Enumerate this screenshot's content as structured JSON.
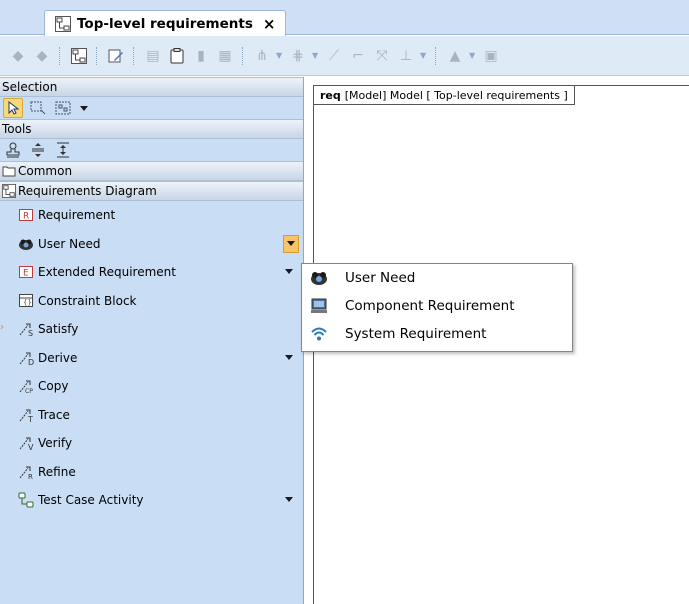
{
  "tab": {
    "title": "Top-level requirements",
    "close": "×",
    "diagram_icon": "requirements-diagram-icon"
  },
  "toolbar": {
    "buttons": [
      "back-arrow-icon",
      "forward-arrow-icon",
      "containment-tree-icon",
      "edit-icon",
      "copy-icon",
      "clipboard-icon",
      "delete-icon",
      "delete-model-icon",
      "layout-icon",
      "route-icon",
      "link-icon",
      "path-icon",
      "rectilinear-icon",
      "align-icon",
      "fill-icon",
      "export-icon"
    ]
  },
  "palette": {
    "selection_header": "Selection",
    "tools_header": "Tools",
    "common_label": "Common",
    "requirements_diagram_label": "Requirements Diagram",
    "items": [
      {
        "label": "Requirement",
        "icon": "requirement-icon"
      },
      {
        "label": "User Need",
        "icon": "user-need-icon"
      },
      {
        "label": "Extended Requirement",
        "icon": "extended-requirement-icon"
      },
      {
        "label": "Constraint Block",
        "icon": "constraint-block-icon"
      },
      {
        "label": "Satisfy",
        "icon": "satisfy-icon",
        "glyph": "S"
      },
      {
        "label": "Derive",
        "icon": "derive-icon",
        "glyph": "D"
      },
      {
        "label": "Copy",
        "icon": "copy-relation-icon",
        "glyph": "CP"
      },
      {
        "label": "Trace",
        "icon": "trace-icon",
        "glyph": "T"
      },
      {
        "label": "Verify",
        "icon": "verify-icon",
        "glyph": "V"
      },
      {
        "label": "Refine",
        "icon": "refine-icon",
        "glyph": "R"
      },
      {
        "label": "Test Case Activity",
        "icon": "test-case-activity-icon"
      }
    ]
  },
  "canvas": {
    "frame_kind": "req",
    "frame_label": "[Model] Model [ Top-level requirements ]"
  },
  "popup": {
    "items": [
      {
        "label": "User Need",
        "icon": "user-need-icon"
      },
      {
        "label": "Component Requirement",
        "icon": "component-requirement-icon"
      },
      {
        "label": "System Requirement",
        "icon": "system-requirement-icon"
      }
    ]
  },
  "colors": {
    "palette_bg": "#c9ddf5",
    "tab_strip_bg": "#cfe0f5",
    "toolbar_bg": "#dfeaf7",
    "selected_tool": "#f7d87a",
    "dropdown_active": "#f8c46a"
  }
}
